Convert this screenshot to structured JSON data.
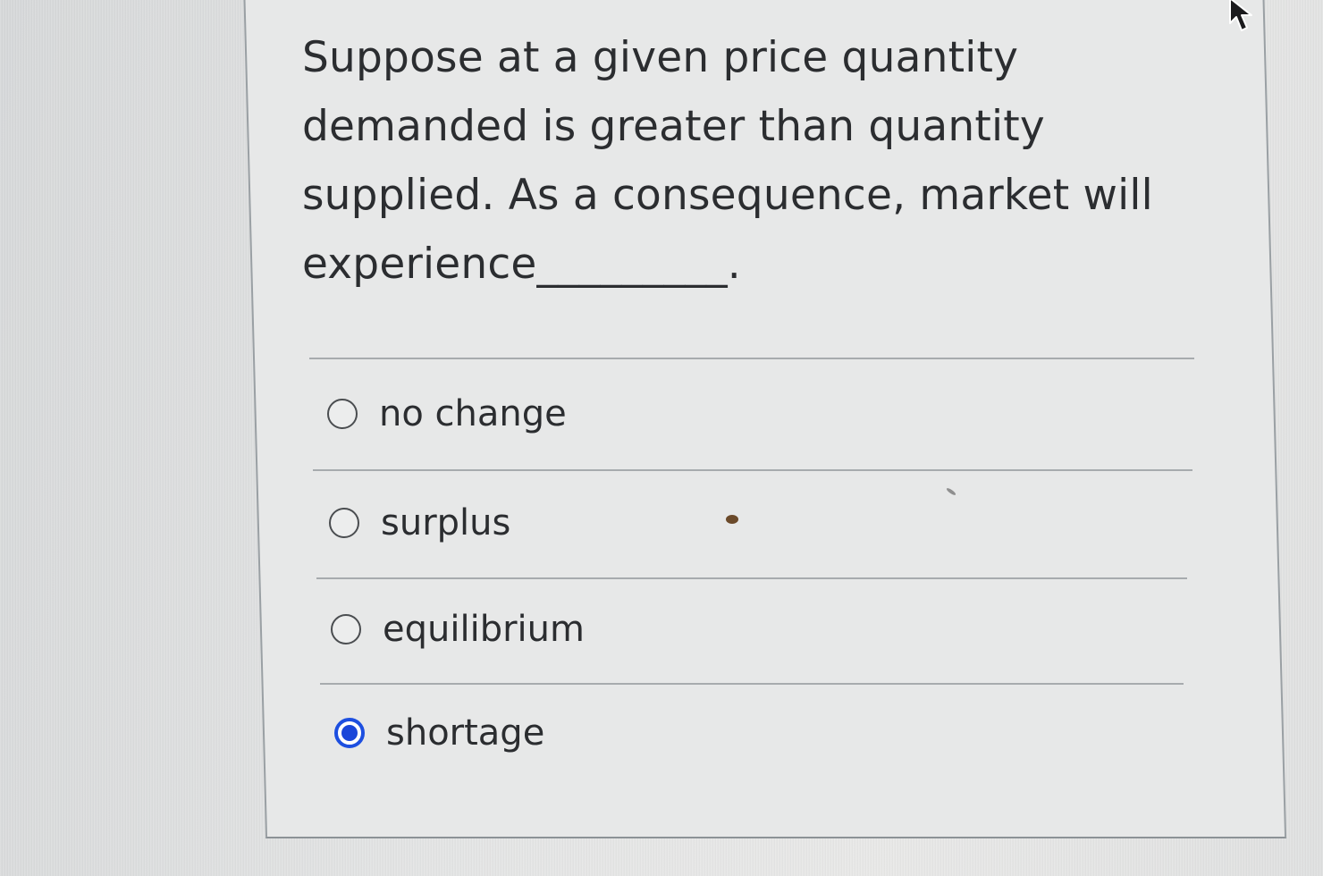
{
  "question": {
    "text": "Suppose at a given price quantity demanded is greater than quantity supplied. As a consequence, market will experience_________."
  },
  "options": [
    {
      "label": "no change",
      "selected": false
    },
    {
      "label": "surplus",
      "selected": false
    },
    {
      "label": "equilibrium",
      "selected": false
    },
    {
      "label": "shortage",
      "selected": true
    }
  ],
  "colors": {
    "selected_radio": "#1d4fe0",
    "text": "#2b2d30"
  },
  "icons": {
    "cursor": "mouse-pointer-icon"
  }
}
